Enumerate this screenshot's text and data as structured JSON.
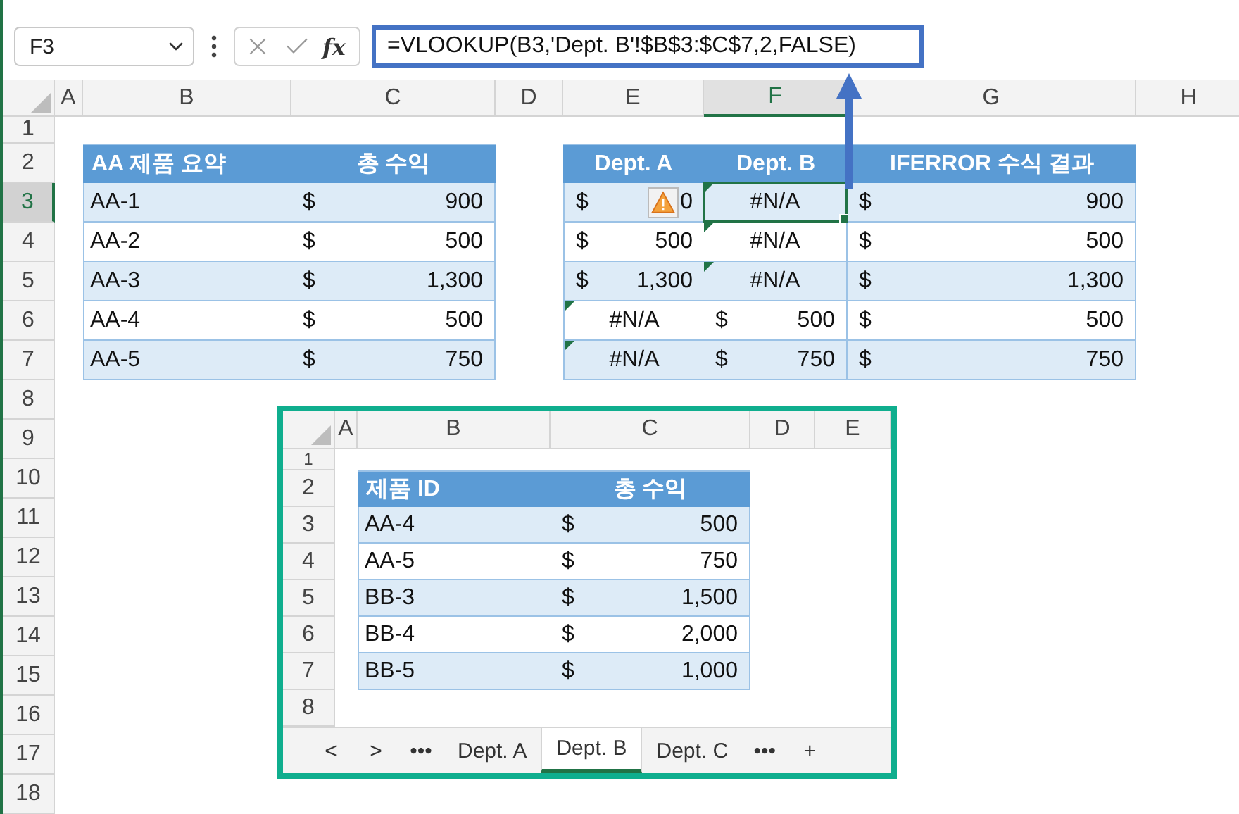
{
  "name_box": "F3",
  "function_label": "fx",
  "formula": "=VLOOKUP(B3,'Dept. B'!$B$3:$C$7,2,FALSE)",
  "columns": [
    {
      "label": "A",
      "selected": false
    },
    {
      "label": "B",
      "selected": false
    },
    {
      "label": "C",
      "selected": false
    },
    {
      "label": "D",
      "selected": false
    },
    {
      "label": "E",
      "selected": false
    },
    {
      "label": "F",
      "selected": true
    },
    {
      "label": "G",
      "selected": false
    },
    {
      "label": "H",
      "selected": false
    }
  ],
  "rows": [
    {
      "label": "1",
      "selected": false
    },
    {
      "label": "2",
      "selected": false
    },
    {
      "label": "3",
      "selected": true
    },
    {
      "label": "4",
      "selected": false
    },
    {
      "label": "5",
      "selected": false
    },
    {
      "label": "6",
      "selected": false
    },
    {
      "label": "7",
      "selected": false
    },
    {
      "label": "8",
      "selected": false
    },
    {
      "label": "9",
      "selected": false
    },
    {
      "label": "10",
      "selected": false
    },
    {
      "label": "11",
      "selected": false
    },
    {
      "label": "12",
      "selected": false
    },
    {
      "label": "13",
      "selected": false
    },
    {
      "label": "14",
      "selected": false
    },
    {
      "label": "15",
      "selected": false
    },
    {
      "label": "16",
      "selected": false
    },
    {
      "label": "17",
      "selected": false
    },
    {
      "label": "18",
      "selected": false
    }
  ],
  "summary_table": {
    "headers": [
      "AA 제품 요약",
      "총 수익"
    ],
    "rows": [
      {
        "id": "AA-1",
        "currency": "$",
        "value": "900"
      },
      {
        "id": "AA-2",
        "currency": "$",
        "value": "500"
      },
      {
        "id": "AA-3",
        "currency": "$",
        "value": "1,300"
      },
      {
        "id": "AA-4",
        "currency": "$",
        "value": "500"
      },
      {
        "id": "AA-5",
        "currency": "$",
        "value": "750"
      }
    ]
  },
  "results_table": {
    "headers": [
      "Dept. A",
      "Dept. B",
      "IFERROR 수식 결과"
    ],
    "rows": [
      {
        "cells": [
          {
            "kind": "money",
            "currency": "$",
            "value": "0",
            "warning": true,
            "error_flag": false,
            "selected": false
          },
          {
            "kind": "error",
            "value": "#N/A",
            "warning": false,
            "error_flag": true,
            "selected": true
          },
          {
            "kind": "money",
            "currency": "$",
            "value": "900",
            "warning": false,
            "error_flag": false,
            "selected": false
          }
        ]
      },
      {
        "cells": [
          {
            "kind": "money",
            "currency": "$",
            "value": "500",
            "warning": false,
            "error_flag": false,
            "selected": false
          },
          {
            "kind": "error",
            "value": "#N/A",
            "warning": false,
            "error_flag": true,
            "selected": false
          },
          {
            "kind": "money",
            "currency": "$",
            "value": "500",
            "warning": false,
            "error_flag": false,
            "selected": false
          }
        ]
      },
      {
        "cells": [
          {
            "kind": "money",
            "currency": "$",
            "value": "1,300",
            "warning": false,
            "error_flag": false,
            "selected": false
          },
          {
            "kind": "error",
            "value": "#N/A",
            "warning": false,
            "error_flag": true,
            "selected": false
          },
          {
            "kind": "money",
            "currency": "$",
            "value": "1,300",
            "warning": false,
            "error_flag": false,
            "selected": false
          }
        ]
      },
      {
        "cells": [
          {
            "kind": "error",
            "value": "#N/A",
            "warning": false,
            "error_flag": true,
            "selected": false
          },
          {
            "kind": "money",
            "currency": "$",
            "value": "500",
            "warning": false,
            "error_flag": false,
            "selected": false
          },
          {
            "kind": "money",
            "currency": "$",
            "value": "500",
            "warning": false,
            "error_flag": false,
            "selected": false
          }
        ]
      },
      {
        "cells": [
          {
            "kind": "error",
            "value": "#N/A",
            "warning": false,
            "error_flag": true,
            "selected": false
          },
          {
            "kind": "money",
            "currency": "$",
            "value": "750",
            "warning": false,
            "error_flag": false,
            "selected": false
          },
          {
            "kind": "money",
            "currency": "$",
            "value": "750",
            "warning": false,
            "error_flag": false,
            "selected": false
          }
        ]
      }
    ]
  },
  "inset": {
    "columns": [
      "A",
      "B",
      "C",
      "D",
      "E"
    ],
    "rows": [
      "1",
      "2",
      "3",
      "4",
      "5",
      "6",
      "7",
      "8"
    ],
    "table": {
      "headers": [
        "제품 ID",
        "총 수익"
      ],
      "rows": [
        {
          "id": "AA-4",
          "currency": "$",
          "value": "500"
        },
        {
          "id": "AA-5",
          "currency": "$",
          "value": "750"
        },
        {
          "id": "BB-3",
          "currency": "$",
          "value": "1,500"
        },
        {
          "id": "BB-4",
          "currency": "$",
          "value": "2,000"
        },
        {
          "id": "BB-5",
          "currency": "$",
          "value": "1,000"
        }
      ]
    },
    "nav": [
      "<",
      ">",
      "•••"
    ],
    "sheet_tabs": [
      {
        "label": "Dept. A",
        "selected": false
      },
      {
        "label": "Dept. B",
        "selected": true
      },
      {
        "label": "Dept. C",
        "selected": false
      }
    ],
    "more": "•••",
    "add": "+"
  }
}
